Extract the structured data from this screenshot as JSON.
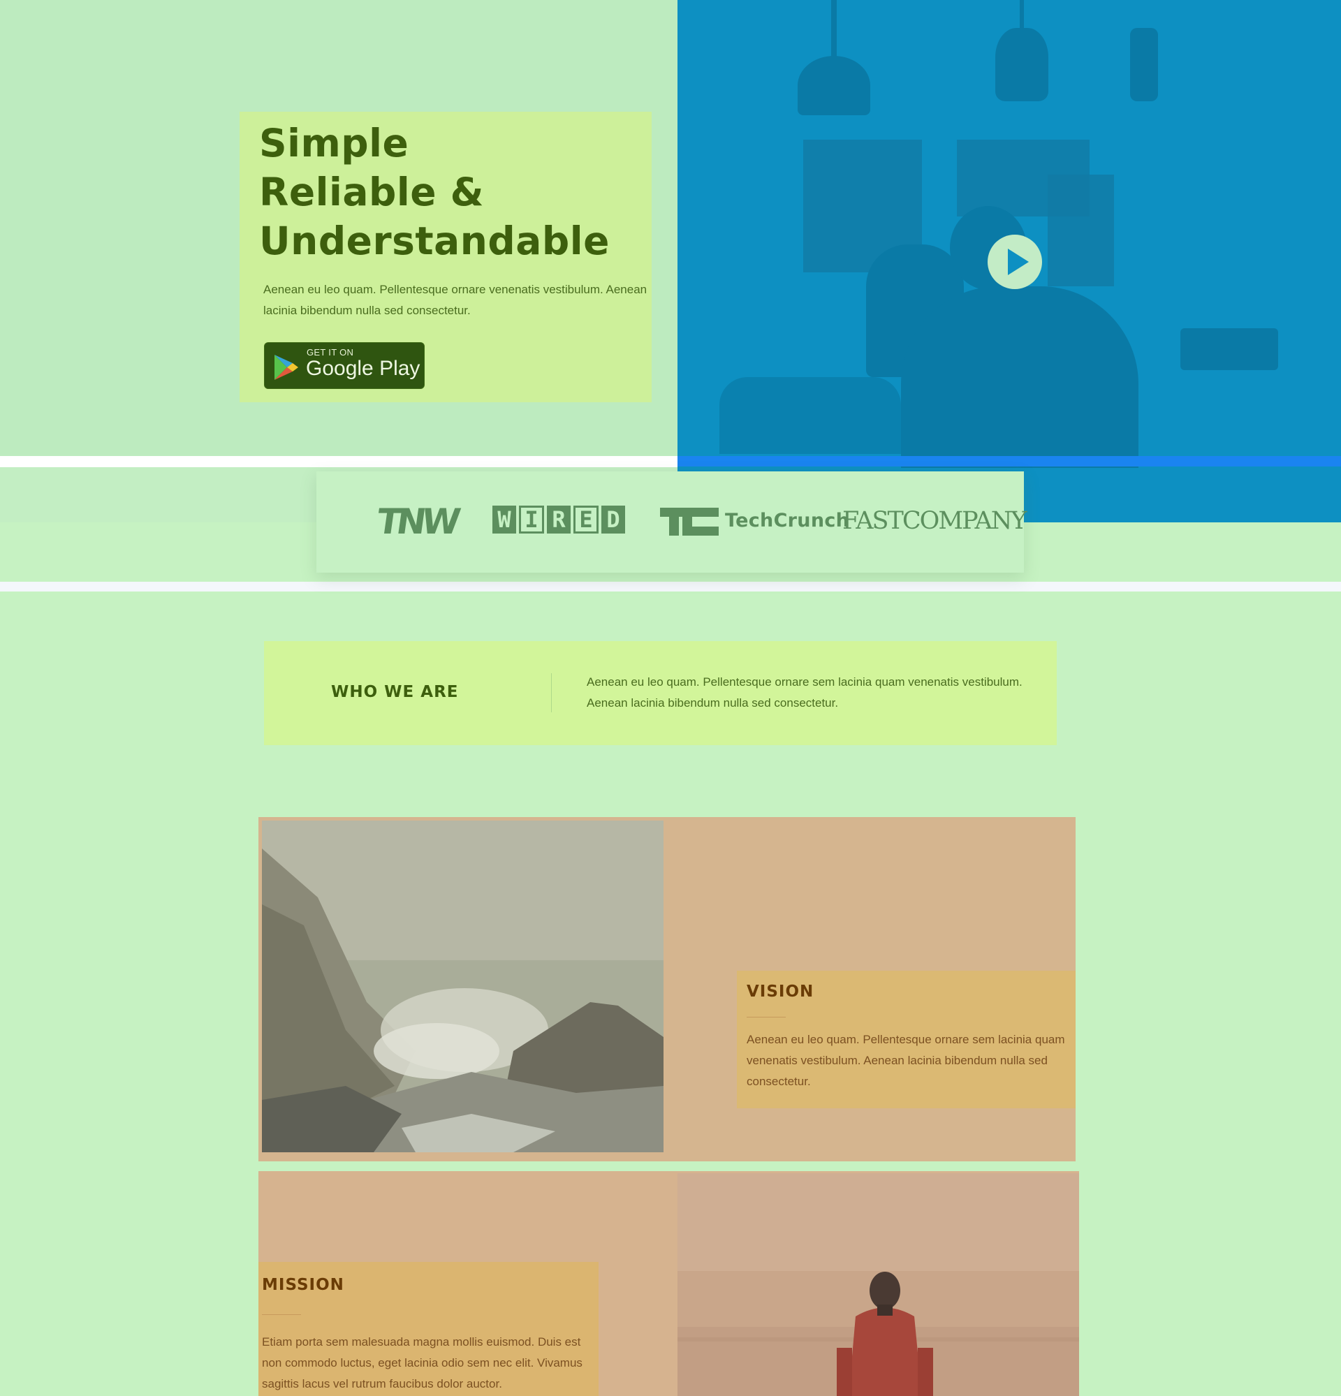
{
  "hero": {
    "title_lines": [
      "Simple",
      "Reliable &",
      "Understandable"
    ],
    "subtitle": "Aenean eu leo quam. Pellentesque ornare venenatis vestibulum. Aenean lacinia bibendum nulla sed consectetur.",
    "store_badge": {
      "small": "GET IT ON",
      "big": "Google Play"
    },
    "video_play_icon": "play-icon"
  },
  "press": {
    "logos": [
      "TNW",
      "WIRED",
      "TechCrunch",
      "FASTCOMPANY"
    ],
    "wired_letters": [
      "W",
      "I",
      "R",
      "E",
      "D"
    ],
    "techcrunch_text": "TechCrunch",
    "fastcompany_text": "FASTCOMPANY"
  },
  "who": {
    "title": "WHO WE ARE",
    "text": "Aenean eu leo quam. Pellentesque ornare sem lacinia quam venenatis vestibulum. Aenean lacinia bibendum nulla sed consectetur."
  },
  "vision": {
    "title": "VISION",
    "text": "Aenean eu leo quam. Pellentesque ornare sem lacinia quam venenatis vestibulum. Aenean lacinia bibendum nulla sed consectetur."
  },
  "mission": {
    "title": "MISSION",
    "text": "Etiam porta sem malesuada magna mollis euismod. Duis  est non commodo luctus, eget lacinia odio sem nec elit. Vivamus sagittis lacus vel rutrum faucibus dolor auctor."
  },
  "colors": {
    "page_bg": "#c6f2c2",
    "hero_card": "#cdf09a",
    "heading_green": "#3d5f0d",
    "video_blue": "#0d90c2",
    "accent_blue": "#1a84f0",
    "who_card": "#d2f59a",
    "feature_card": "#d5b58f",
    "feature_box": "#dbb973",
    "feature_title": "#6a3c06"
  }
}
